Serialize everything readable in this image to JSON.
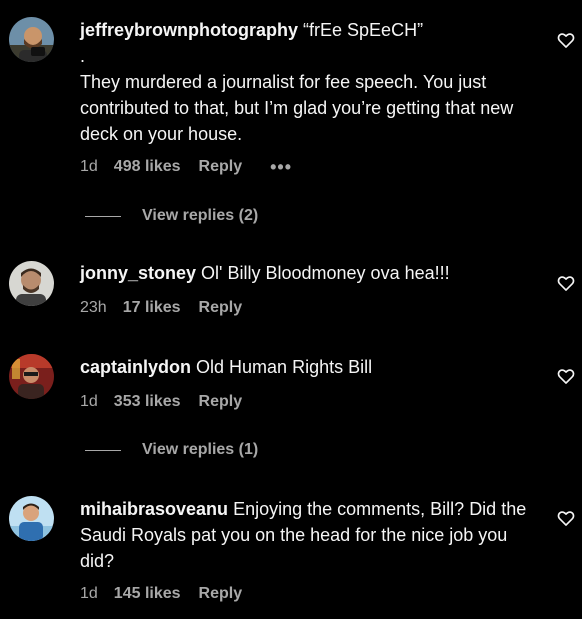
{
  "comments": [
    {
      "username": "jeffreybrownphotography",
      "text_lines": [
        "“frEe SpEeCH”",
        ".",
        "They murdered a journalist for fee speech. You just contributed to that, but I’m glad you’re getting that new deck on your house."
      ],
      "time": "1d",
      "likes": "498 likes",
      "reply": "Reply",
      "more": "•••",
      "view_replies": "View replies (2)",
      "avatar_icon": "profile-photo-bearded-man-icon"
    },
    {
      "username": "jonny_stoney",
      "text": "Ol' Billy Bloodmoney ova hea!!!",
      "time": "23h",
      "likes": "17 likes",
      "reply": "Reply",
      "avatar_icon": "profile-photo-man-icon"
    },
    {
      "username": "captainlydon",
      "text": "Old Human Rights Bill",
      "time": "1d",
      "likes": "353 likes",
      "reply": "Reply",
      "view_replies": "View replies (1)",
      "avatar_icon": "profile-photo-red-scene-icon"
    },
    {
      "username": "mihaibrasoveanu",
      "text": "Enjoying the comments, Bill? Did the Saudi Royals pat you on the head for the nice job you did?",
      "time": "1d",
      "likes": "145 likes",
      "reply": "Reply",
      "avatar_icon": "profile-photo-man-blue-shirt-icon"
    }
  ],
  "colors": {
    "background": "#000000",
    "primary_text": "#f5f5f5",
    "secondary_text": "#a8a8a8"
  }
}
